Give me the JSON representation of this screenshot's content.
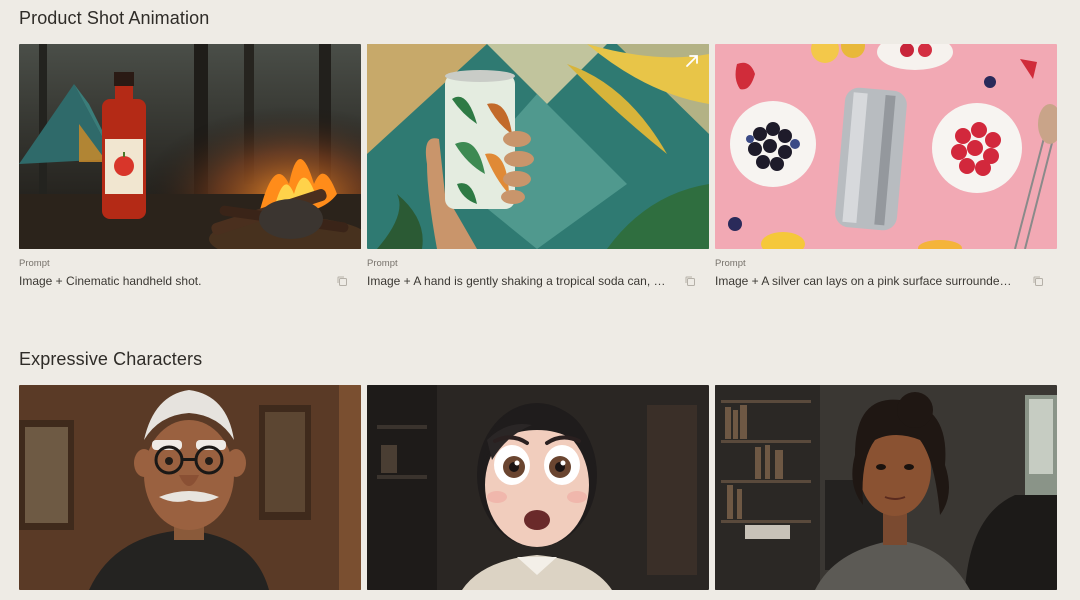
{
  "sections": [
    {
      "title": "Product Shot Animation",
      "cards": [
        {
          "prompt_label": "Prompt",
          "prompt_text": "Image + Cinematic handheld shot.",
          "thumb_icon": "campfire-hot-sauce-image"
        },
        {
          "prompt_label": "Prompt",
          "prompt_text": "Image + A hand is gently shaking a tropical soda can, th…",
          "thumb_icon": "tropical-soda-can-image",
          "has_expand": true
        },
        {
          "prompt_label": "Prompt",
          "prompt_text": "Image + A silver can lays on a pink surface surrounded …",
          "thumb_icon": "silver-can-berries-image"
        }
      ]
    },
    {
      "title": "Expressive Characters",
      "cards": [
        {
          "thumb_icon": "old-man-character-image"
        },
        {
          "thumb_icon": "surprised-girl-character-image"
        },
        {
          "thumb_icon": "woman-portrait-image"
        }
      ]
    }
  ],
  "colors": {
    "background": "#eeebe5",
    "text": "#2f2c28",
    "muted": "#77726b"
  }
}
